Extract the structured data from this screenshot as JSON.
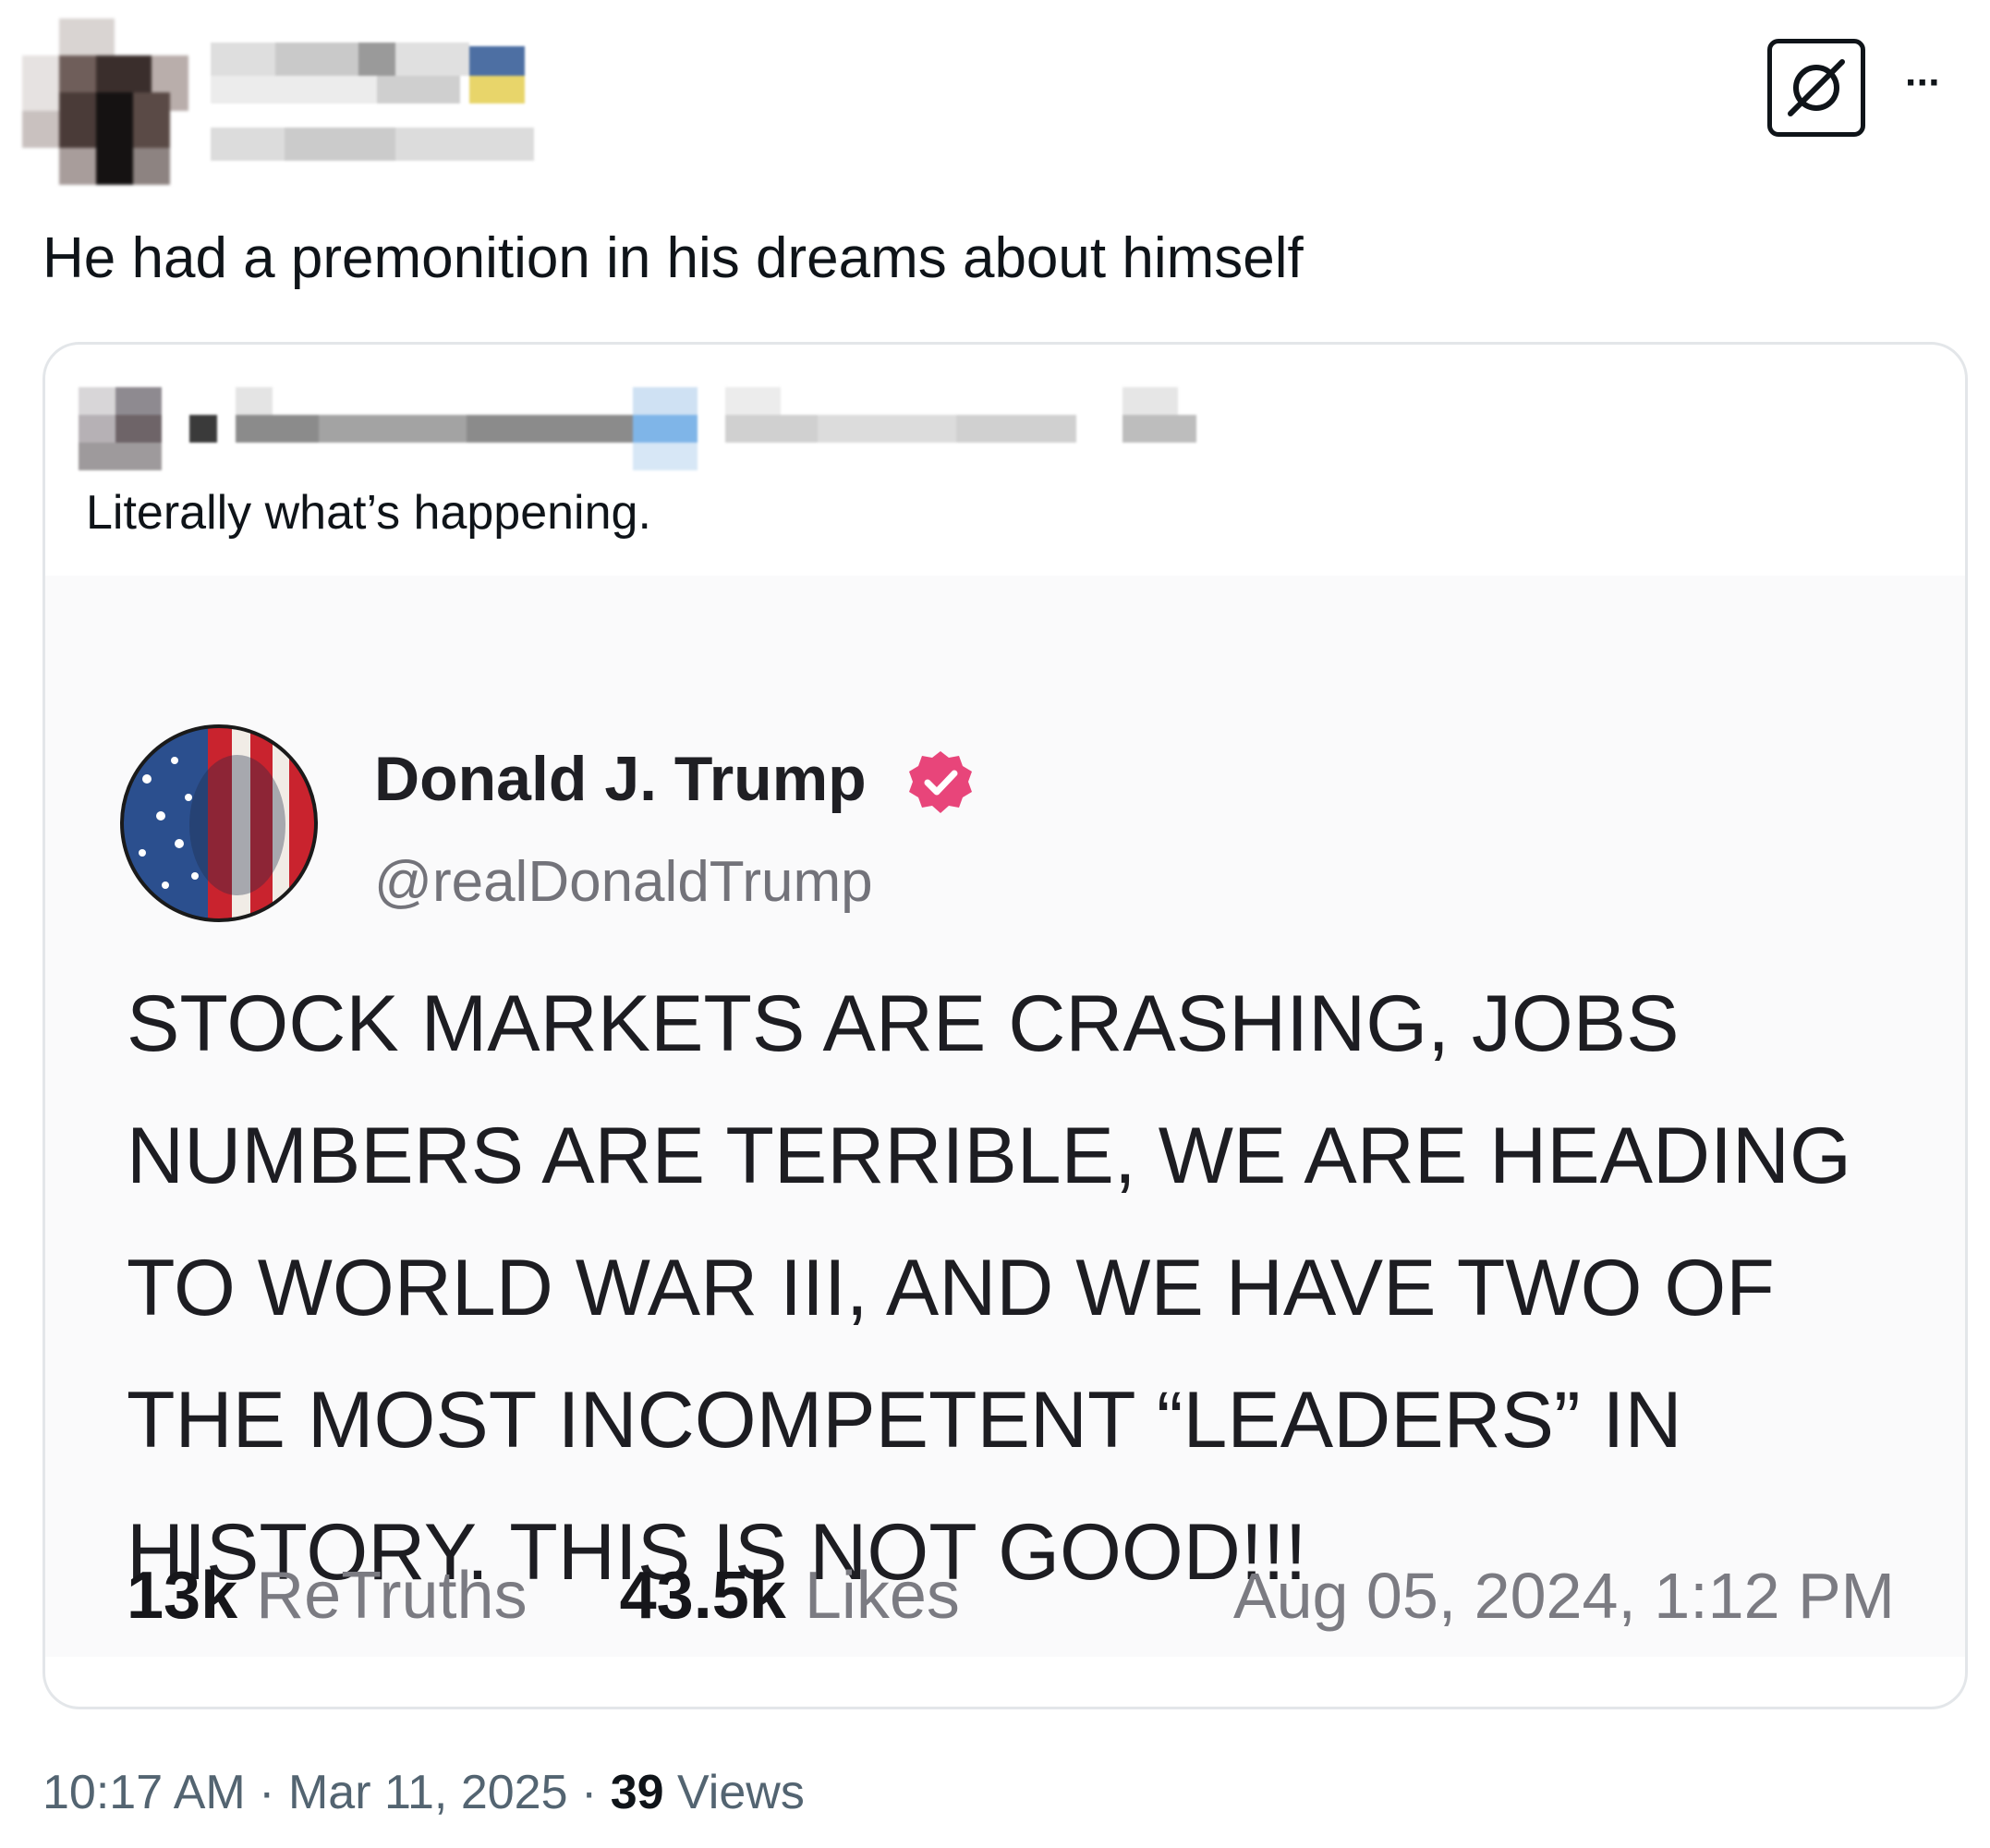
{
  "post": {
    "text": "He had a premonition in his dreams about himself",
    "timestamp": "10:17 AM",
    "separator": "·",
    "date": "Mar 11, 2025",
    "views_count": "39",
    "views_label": "Views",
    "more_glyph": "···"
  },
  "quote": {
    "text": "Literally what’s happening."
  },
  "truth": {
    "author_name": "Donald J. Trump",
    "handle": "@realDonaldTrump",
    "body_lines": [
      "STOCK MARKETS ARE CRASHING, JOBS",
      "NUMBERS ARE TERRIBLE, WE ARE HEADING",
      "TO WORLD WAR III, AND WE HAVE TWO OF",
      "THE MOST INCOMPETENT “LEADERS” IN",
      "HISTORY. THIS IS NOT GOOD!!!"
    ],
    "retruths_count": "13k",
    "retruths_label": "ReTruths",
    "likes_count": "43.5k",
    "likes_label": "Likes",
    "date": "Aug 05, 2024, 1:12 PM"
  },
  "colors": {
    "text_primary": "#0f1419",
    "text_secondary": "#536471",
    "badge": "#e8457a",
    "card_border": "#e3e6e9",
    "embed_bg": "#fafafb"
  },
  "icons": {
    "corner": "no-symbol-icon",
    "more": "more-horizontal-icon",
    "verified": "verified-badge-icon"
  }
}
